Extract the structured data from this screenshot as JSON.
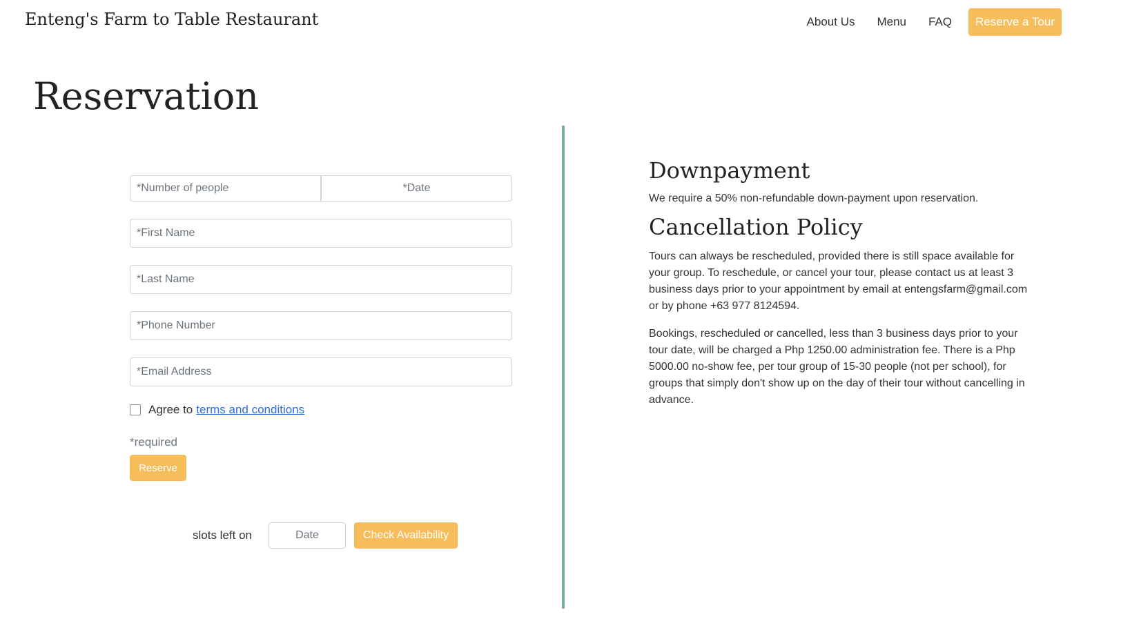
{
  "brand": "Enteng's Farm to Table Restaurant",
  "nav": {
    "items": [
      "About Us",
      "Menu",
      "FAQ"
    ],
    "cta": "Reserve a Tour"
  },
  "page_title": "Reservation",
  "form": {
    "people_placeholder": "*Number of people",
    "date_placeholder": "*Date",
    "first_name_placeholder": "*First Name",
    "last_name_placeholder": "*Last Name",
    "phone_placeholder": "*Phone Number",
    "email_placeholder": "*Email Address",
    "agree_text": "Agree to",
    "terms_link": "terms and conditions",
    "required_note": "*required",
    "reserve_label": "Reserve"
  },
  "availability": {
    "label": "slots left on",
    "date_placeholder": "Date",
    "button": "Check Availability"
  },
  "info": {
    "downpayment_title": "Downpayment",
    "downpayment_text": "We require a 50% non-refundable down-payment upon reservation.",
    "cancellation_title": "Cancellation Policy",
    "cancellation_p1": "Tours can always be rescheduled, provided there is still space available for your group. To reschedule, or cancel your tour, please contact us at least 3 business days prior to your appointment by email at entengsfarm@gmail.com or by phone +63 977 8124594.",
    "cancellation_p2": "Bookings, rescheduled or cancelled, less than 3 business days prior to your tour date, will be charged a Php 1250.00 administration fee. There is a Php 5000.00 no-show fee, per tour group of 15-30 people (not per school), for groups that simply don't show up on the day of their tour without cancelling in advance."
  },
  "colors": {
    "accent": "#f8bd5b",
    "divider": "#7ab39a",
    "link": "#2a6fdb"
  }
}
